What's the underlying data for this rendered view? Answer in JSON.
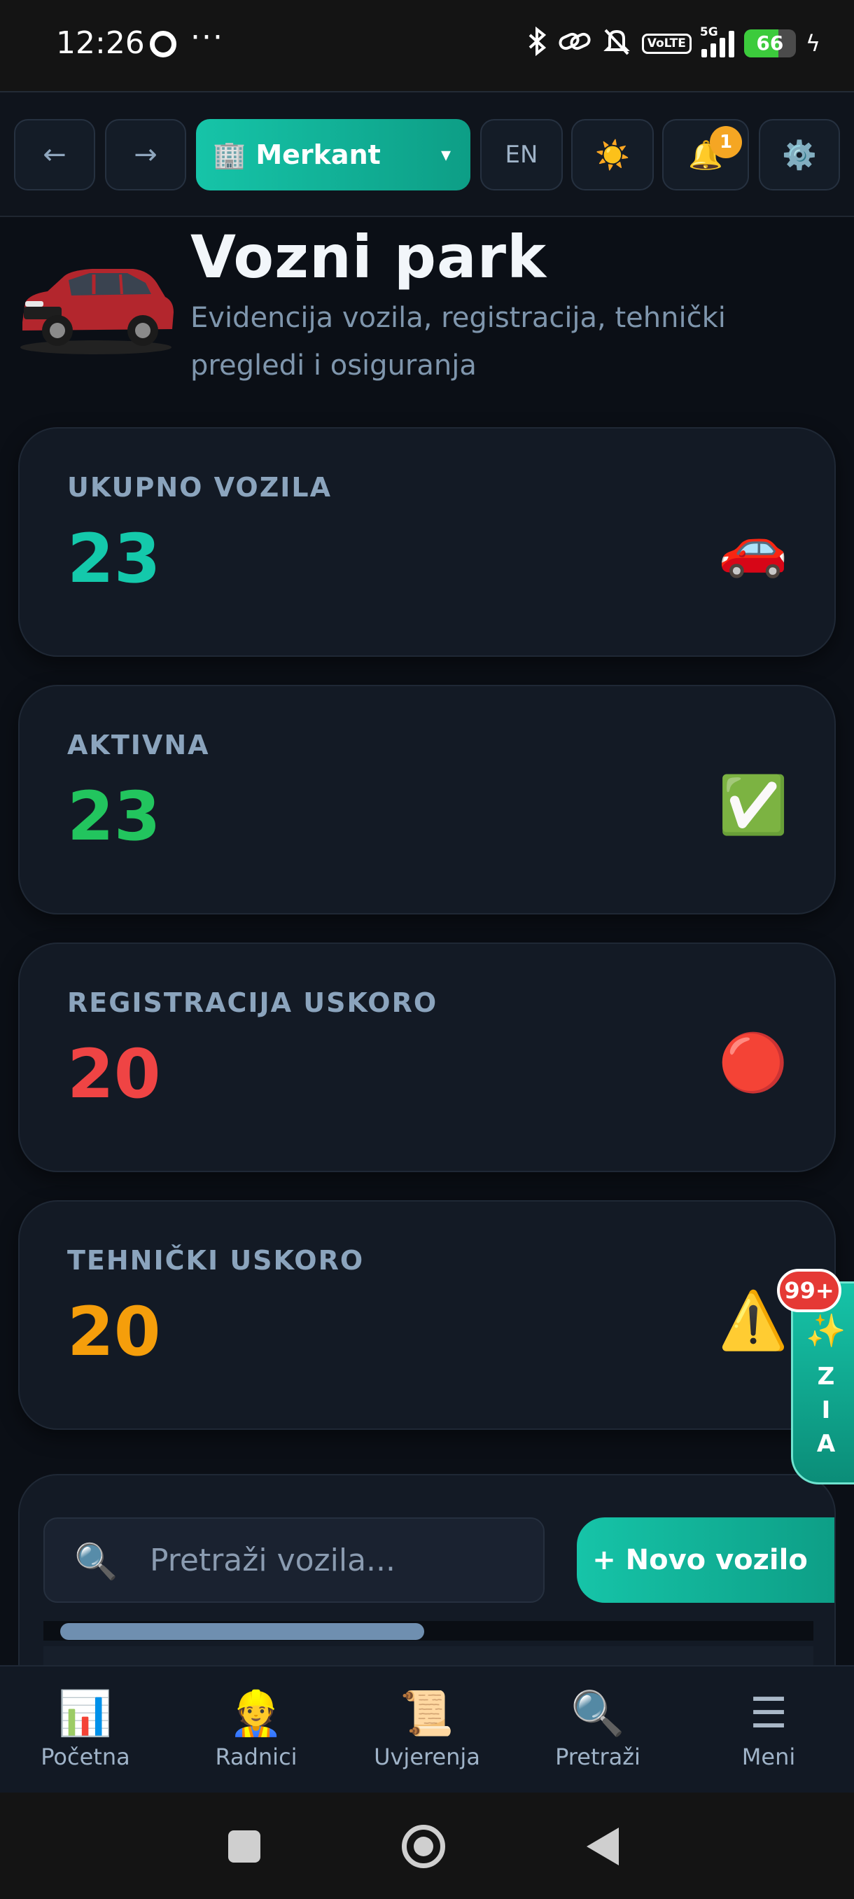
{
  "status_bar": {
    "time": "12:26",
    "more": "···",
    "volte": "VoLTE",
    "network": "5G",
    "battery_level": "66",
    "battery_fraction": 0.66
  },
  "toolbar": {
    "back": "←",
    "forward": "→",
    "company_icon": "🏢",
    "company": "Merkant",
    "caret": "▾",
    "language": "EN",
    "theme_icon": "☀️",
    "bell_icon": "🔔",
    "notification_count": "1",
    "settings_icon": "⚙️"
  },
  "header": {
    "title": "Vozni park",
    "subtitle": "Evidencija vozila, registracija, tehnički pregledi i osiguranja"
  },
  "stats": [
    {
      "label": "UKUPNO VOZILA",
      "value": "23",
      "icon": "🚗",
      "color": "#14c9ab"
    },
    {
      "label": "AKTIVNA",
      "value": "23",
      "icon": "✅",
      "color": "#22c55e"
    },
    {
      "label": "REGISTRACIJA USKORO",
      "value": "20",
      "icon": "🔴",
      "color": "#ef4444"
    },
    {
      "label": "TEHNIČKI USKORO",
      "value": "20",
      "icon": "⚠️",
      "color": "#f59e0b"
    }
  ],
  "zia": {
    "badge": "99+",
    "spark_icon": "✨",
    "letters": [
      "Z",
      "I",
      "A"
    ]
  },
  "vehicles": {
    "search_icon": "🔍",
    "search_placeholder": "Pretraži vozila...",
    "new_button": "+ Novo vozilo"
  },
  "bottom_nav": [
    {
      "icon": "📊",
      "label": "Početna"
    },
    {
      "icon": "👷",
      "label": "Radnici"
    },
    {
      "icon": "📜",
      "label": "Uvjerenja"
    },
    {
      "icon": "🔍",
      "label": "Pretraži"
    },
    {
      "icon": "☰",
      "label": "Meni"
    }
  ],
  "colors": {
    "accent": "#16c4a8",
    "background": "#0b0f16",
    "card": "#131a25"
  }
}
